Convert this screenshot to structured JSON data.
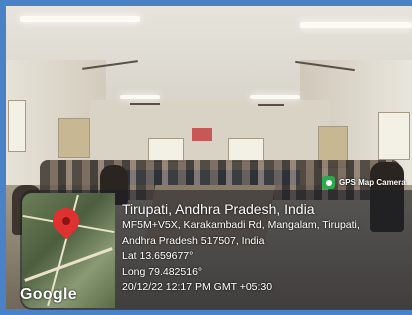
{
  "badge": {
    "label": "GPS Map Camera",
    "icon": "map-camera-icon"
  },
  "map": {
    "brand": "Google",
    "pin_icon": "location-pin-icon"
  },
  "location": {
    "title": "Tirupati, Andhra Pradesh, India",
    "address_line1": "MF5M+V5X, Karakambadi Rd, Mangalam, Tirupati,",
    "address_line2": "Andhra Pradesh 517507, India",
    "latitude": "Lat 13.659677°",
    "longitude": "Long 79.482516°",
    "timestamp": "20/12/22 12:17 PM GMT +05:30"
  },
  "colors": {
    "border": "#4a82c7",
    "pin": "#e03131",
    "badge_icon": "#2fa84f"
  }
}
